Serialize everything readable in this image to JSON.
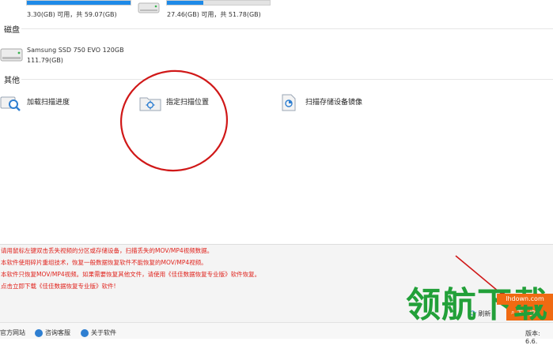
{
  "drives": [
    {
      "size_text": "3.30(GB) 可用，共 59.07(GB)",
      "fill_fraction": 1.0
    },
    {
      "size_text": "27.46(GB) 可用，共 51.78(GB)",
      "fill_fraction": 0.35
    }
  ],
  "disk_section": {
    "title": "磁盘",
    "disks": [
      {
        "name": "Samsung SSD 750 EVO 120GB",
        "size": "111.79(GB)"
      }
    ]
  },
  "other_section": {
    "title": "其他",
    "items": [
      {
        "label": "加载扫描进度",
        "icon": "magnifier-card-icon"
      },
      {
        "label": "指定扫描位置",
        "icon": "folder-target-icon"
      },
      {
        "label": "扫描存储设备镜像",
        "icon": "disk-image-icon"
      }
    ]
  },
  "messages": [
    "请用鼠标左键双击丢失视频的分区或存储设备，扫描丢失的MOV/MP4视频数据。",
    "本软件使用碎片重组技术，恢复一般数据恢复软件不能恢复的MOV/MP4视频。",
    "本软件只恢复MOV/MP4视频。如果需要恢复其他文件，请使用《佳佳数据恢复专业版》软件恢复。",
    "点击立即下载《佳佳数据恢复专业版》软件!"
  ],
  "footer": {
    "official_site": "官方网站",
    "consult": "咨询客服",
    "about": "关于软件",
    "version": "版本: 6.6."
  },
  "action_buttons": {
    "refresh": "刷新",
    "next": "下一步"
  },
  "watermark": {
    "text": "领航下载",
    "url": "lhdown.com"
  },
  "colors": {
    "accent": "#1e8ae8",
    "message_red": "#e0231d",
    "annotation_red": "#d01818"
  }
}
